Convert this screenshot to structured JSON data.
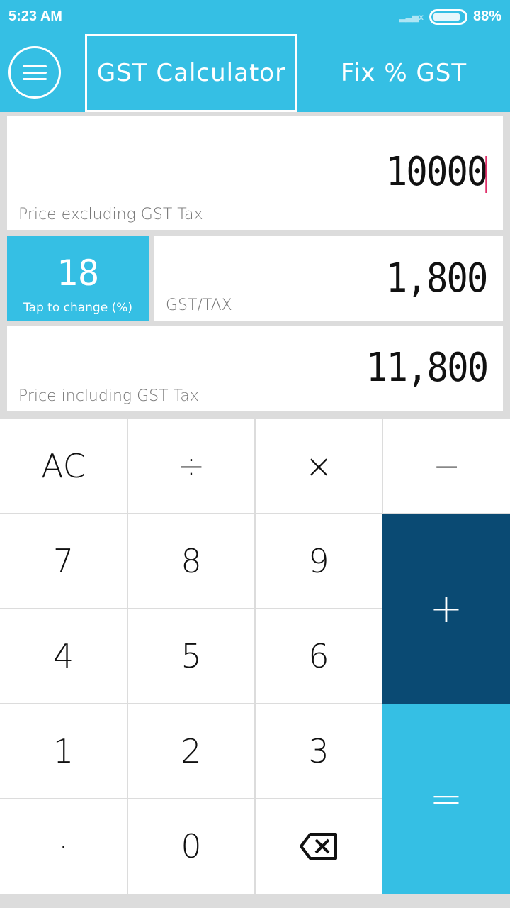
{
  "status": {
    "time": "5:23 AM",
    "battery": "88%",
    "battery_level": 0.88
  },
  "header": {
    "tabs": [
      {
        "label": "GST Calculator",
        "active": true
      },
      {
        "label": "Fix % GST",
        "active": false
      }
    ]
  },
  "price_excl": {
    "value": "10000",
    "label": "Price excluding GST Tax"
  },
  "rate": {
    "value": "18",
    "label": "Tap to change (%)"
  },
  "gst": {
    "value": "1,800",
    "label": "GST/TAX"
  },
  "price_incl": {
    "value": "11,800",
    "label": "Price including GST Tax"
  },
  "keys": {
    "ac": "AC",
    "div": "÷",
    "mul": "×",
    "sub": "−",
    "k7": "7",
    "k8": "8",
    "k9": "9",
    "add": "+",
    "k4": "4",
    "k5": "5",
    "k6": "6",
    "k1": "1",
    "k2": "2",
    "k3": "3",
    "eq": "=",
    "dot": "·",
    "k0": "0"
  },
  "colors": {
    "primary": "#35bfe4",
    "plus": "#0a4a73",
    "cursor": "#e0306a"
  }
}
